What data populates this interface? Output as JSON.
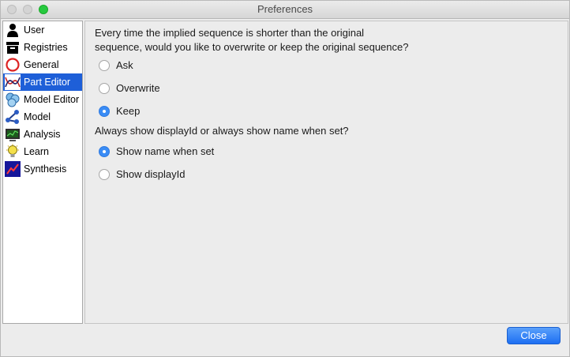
{
  "window": {
    "title": "Preferences"
  },
  "sidebar": {
    "items": [
      {
        "label": "User",
        "icon": "user-icon",
        "selected": false
      },
      {
        "label": "Registries",
        "icon": "registries-icon",
        "selected": false
      },
      {
        "label": "General",
        "icon": "general-icon",
        "selected": false
      },
      {
        "label": "Part Editor",
        "icon": "part-editor-icon",
        "selected": true
      },
      {
        "label": "Model Editor",
        "icon": "model-editor-icon",
        "selected": false
      },
      {
        "label": "Model",
        "icon": "model-icon",
        "selected": false
      },
      {
        "label": "Analysis",
        "icon": "analysis-icon",
        "selected": false
      },
      {
        "label": "Learn",
        "icon": "learn-icon",
        "selected": false
      },
      {
        "label": "Synthesis",
        "icon": "synthesis-icon",
        "selected": false
      }
    ],
    "selected_color": "#1e5fd8"
  },
  "content": {
    "q1_line1": "Every time the implied sequence is shorter than the original",
    "q1_line2": "sequence, would you like to overwrite or keep the original sequence?",
    "q1_options": [
      {
        "label": "Ask",
        "checked": false
      },
      {
        "label": "Overwrite",
        "checked": false
      },
      {
        "label": "Keep",
        "checked": true
      }
    ],
    "q2": "Always show displayId or always show name when set?",
    "q2_options": [
      {
        "label": "Show name when set",
        "checked": true
      },
      {
        "label": "Show displayId",
        "checked": false
      }
    ]
  },
  "footer": {
    "close_label": "Close"
  }
}
